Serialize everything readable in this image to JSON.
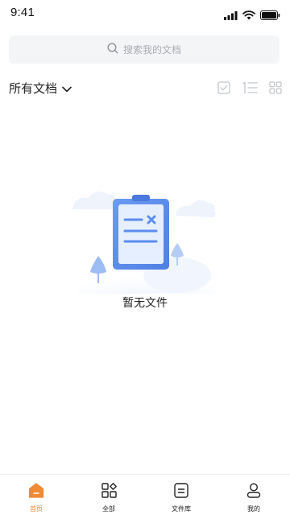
{
  "status_bar": {
    "time": "9:41"
  },
  "search": {
    "placeholder": "搜索我的文档"
  },
  "toolbar": {
    "filter_label": "所有文档",
    "icons": [
      "checkbox-icon",
      "sort-list-icon",
      "grid-view-icon"
    ]
  },
  "empty_state": {
    "message": "暂无文件"
  },
  "tabs": [
    {
      "label": "首页",
      "icon": "home-icon",
      "active": true
    },
    {
      "label": "全部",
      "icon": "all-apps-icon",
      "active": false
    },
    {
      "label": "文件库",
      "icon": "file-library-icon",
      "active": false
    },
    {
      "label": "我的",
      "icon": "profile-icon",
      "active": false
    }
  ],
  "colors": {
    "accent": "#f08a36",
    "illustration_blue": "#5b8def"
  }
}
